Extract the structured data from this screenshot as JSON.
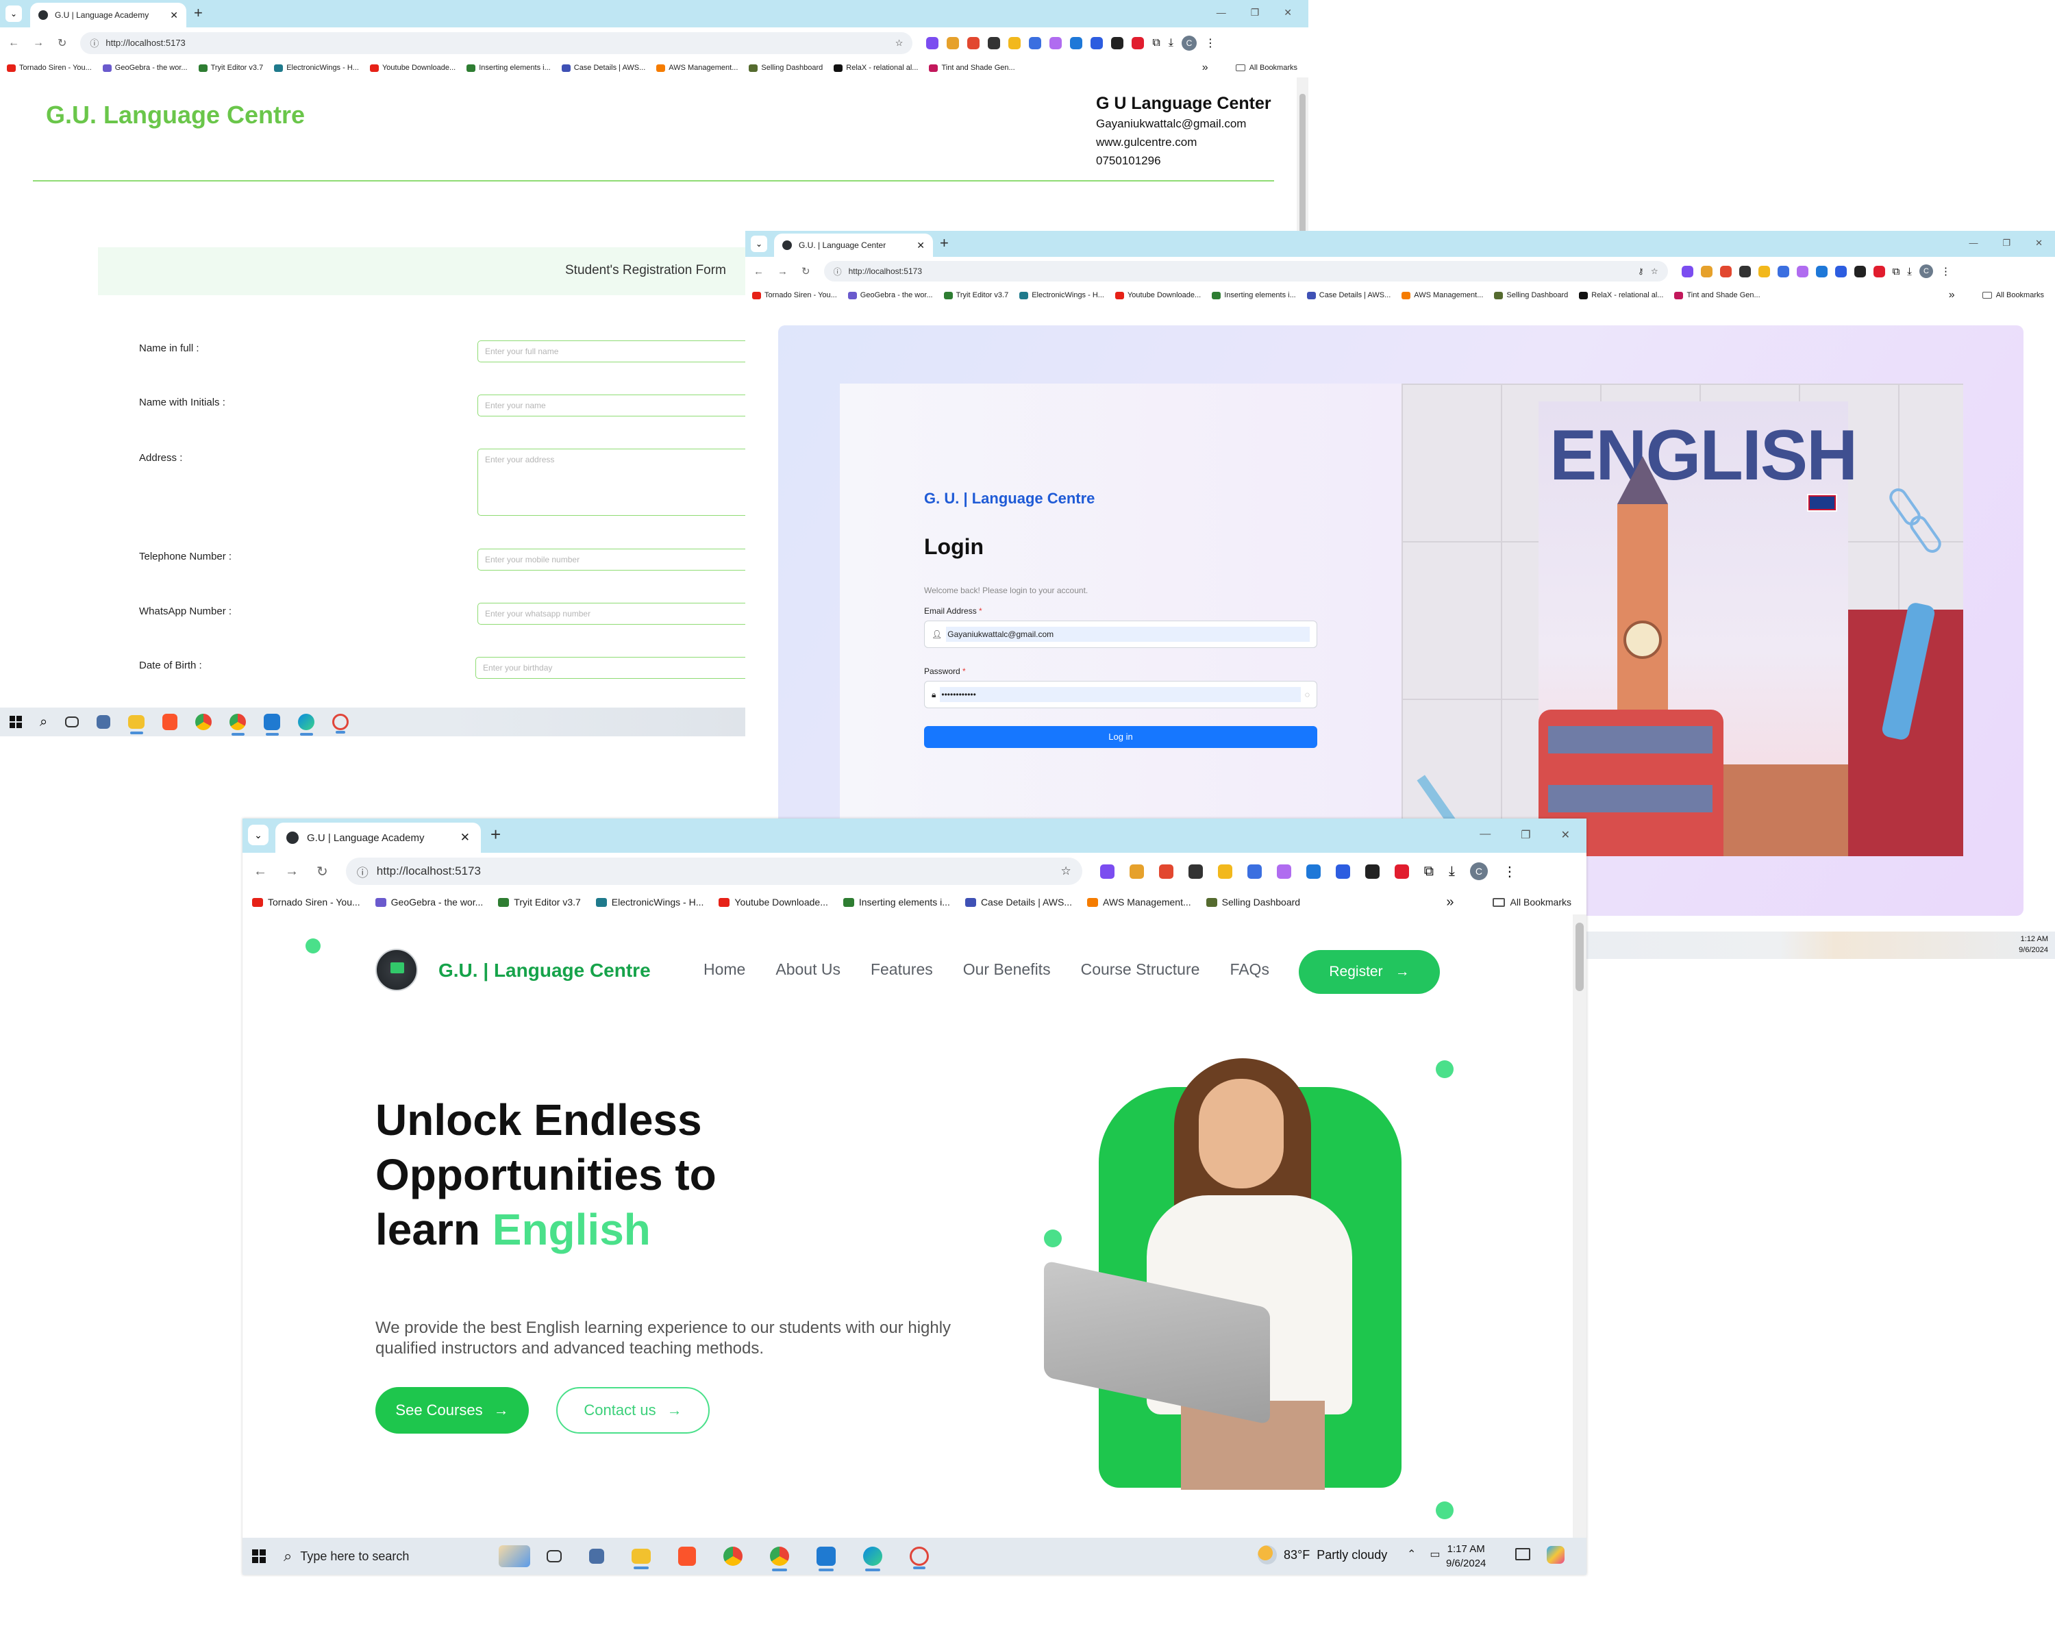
{
  "colors": {
    "accent_green": "#22c55e",
    "login_blue": "#1677ff",
    "titlebar": "#bfe6f3",
    "reg_green": "#6ac64a"
  },
  "browser": {
    "url": "http://localhost:5173",
    "bookmarks": [
      "Tornado Siren - You...",
      "GeoGebra - the wor...",
      "Tryit Editor v3.7",
      "ElectronicWings - H...",
      "Youtube Downloade...",
      "Inserting elements i...",
      "Case Details | AWS...",
      "AWS Management...",
      "Selling Dashboard",
      "RelaX - relational al...",
      "Tint and Shade Gen..."
    ],
    "bookmarks_more": "»",
    "all_bookmarks": "All Bookmarks",
    "profile_initial": "C"
  },
  "windows": {
    "registration": {
      "tab_title": "G.U | Language Academy",
      "brand": "G.U. Language Centre",
      "contact": {
        "name": "G U Language Center",
        "email": "Gayaniukwattalc@gmail.com",
        "web": "www.gulcentre.com",
        "phone": "0750101296"
      },
      "form_title": "Student's Registration Form",
      "fields": [
        {
          "label": "Name in full :",
          "placeholder": "Enter your full name"
        },
        {
          "label": "Name with Initials :",
          "placeholder": "Enter your name"
        },
        {
          "label": "Address :",
          "placeholder": "Enter your address"
        },
        {
          "label": "Telephone Number :",
          "placeholder": "Enter your mobile number"
        },
        {
          "label": "WhatsApp Number :",
          "placeholder": "Enter your whatsapp number"
        },
        {
          "label": "Date of Birth :",
          "placeholder": "Enter your birthday"
        }
      ]
    },
    "login": {
      "tab_title": "G.U. | Language Center",
      "brand": "G. U. | Language Centre",
      "heading": "Login",
      "welcome": "Welcome back! Please login to your account.",
      "email_label": "Email Address",
      "email_value": "Gayaniukwattalc@gmail.com",
      "password_label": "Password",
      "password_value": "••••••••••••",
      "required_mark": "*",
      "login_button": "Log in",
      "poster_word": "ENGLISH",
      "clock_time": "1:12 AM",
      "clock_date": "9/6/2024"
    },
    "home": {
      "tab_title": "G.U | Language Academy",
      "brand": "G.U. | Language Centre",
      "nav": [
        "Home",
        "About Us",
        "Features",
        "Our Benefits",
        "Course Structure",
        "FAQs"
      ],
      "register_button": "Register",
      "hero_line1": "Unlock Endless",
      "hero_line2": "Opportunities to",
      "hero_line3_pre": "learn ",
      "hero_line3_accent": "English",
      "hero_desc": "We provide the best English learning experience to our students with our highly qualified instructors and advanced teaching methods.",
      "see_courses": "See Courses",
      "contact_us": "Contact us"
    }
  },
  "taskbar": {
    "search_placeholder": "Type here to search",
    "weather_temp": "83°F",
    "weather_desc": "Partly cloudy",
    "time": "1:17 AM",
    "date": "9/6/2024"
  }
}
